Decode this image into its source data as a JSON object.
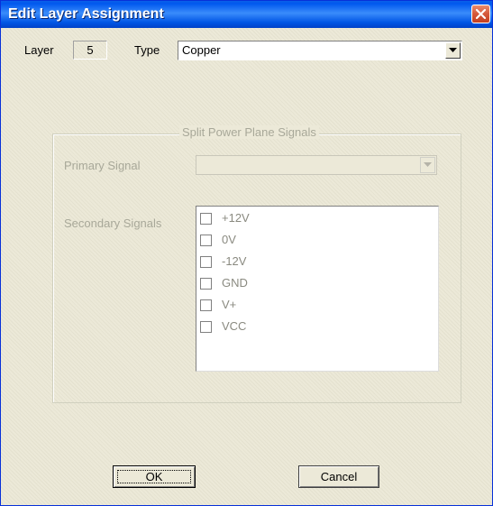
{
  "window": {
    "title": "Edit Layer Assignment"
  },
  "layer": {
    "label": "Layer",
    "value": "5"
  },
  "type": {
    "label": "Type",
    "selected": "Copper"
  },
  "split_power": {
    "group_title": "Split Power Plane Signals",
    "primary_label": "Primary Signal",
    "primary_value": "",
    "secondary_label": "Secondary Signals",
    "signals": [
      {
        "label": "+12V",
        "checked": false
      },
      {
        "label": "0V",
        "checked": false
      },
      {
        "label": "-12V",
        "checked": false
      },
      {
        "label": "GND",
        "checked": false
      },
      {
        "label": "V+",
        "checked": false
      },
      {
        "label": "VCC",
        "checked": false
      }
    ]
  },
  "buttons": {
    "ok": "OK",
    "cancel": "Cancel"
  },
  "colors": {
    "title_bar": "#0058ee",
    "close_button": "#d5583a",
    "dialog_bg": "#ece9d8",
    "disabled_text": "#a8a899"
  },
  "icons": {
    "close": "close-icon",
    "dropdown": "chevron-down-icon"
  }
}
